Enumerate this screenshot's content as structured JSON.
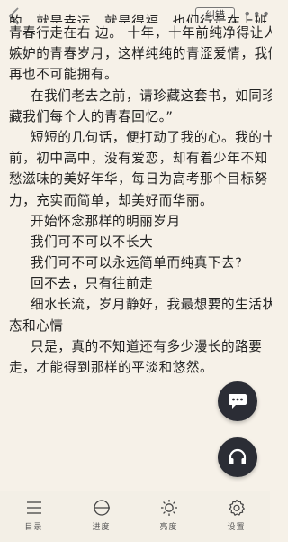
{
  "top_bar": {
    "correct_label": "纠错",
    "more_label": "•••"
  },
  "content": {
    "lines": [
      "的，就是幸运，就是得福。也们行走在上班，",
      "青春行走在右  边。 十年，十年前纯净得让人",
      "嫉妒的青春岁月，这样纯纯的青涩爱情，我们",
      "再也不可能拥有。",
      "在我们老去之前，请珍藏这套书，如同珍",
      "藏我们每个人的青春回忆。”",
      "短短的几句话，便打动了我的心。我的十年",
      "前，初中高中，没有爱恋，却有着少年不知",
      "愁滋味的美好年华，每日为高考那个目标努",
      "力，充实而简单，却美好而华丽。",
      "开始怀念那样的明丽岁月",
      "我们可不可以不长大",
      "我们可不可以永远简单而纯真下去?",
      "回不去，只有往前走",
      "细水长流，岁月静好，我最想要的生活状",
      "态和心情",
      "只是，真的不知道还有多少漫长的路要",
      "走，才能得到那样的平淡和悠然。"
    ]
  },
  "bottom_nav": {
    "catalog": "目录",
    "progress": "进度",
    "brightness": "亮度",
    "settings": "设置"
  },
  "icons": {
    "back": "back-chevron-icon",
    "chat": "comment-bubble-icon",
    "audio": "headphones-icon",
    "catalog": "list-icon",
    "progress": "progress-circle-icon",
    "brightness": "sun-icon",
    "settings": "gear-icon"
  },
  "colors": {
    "page_background": "#f6f1e8",
    "text": "#222222",
    "fab_background": "#2b2d35"
  }
}
